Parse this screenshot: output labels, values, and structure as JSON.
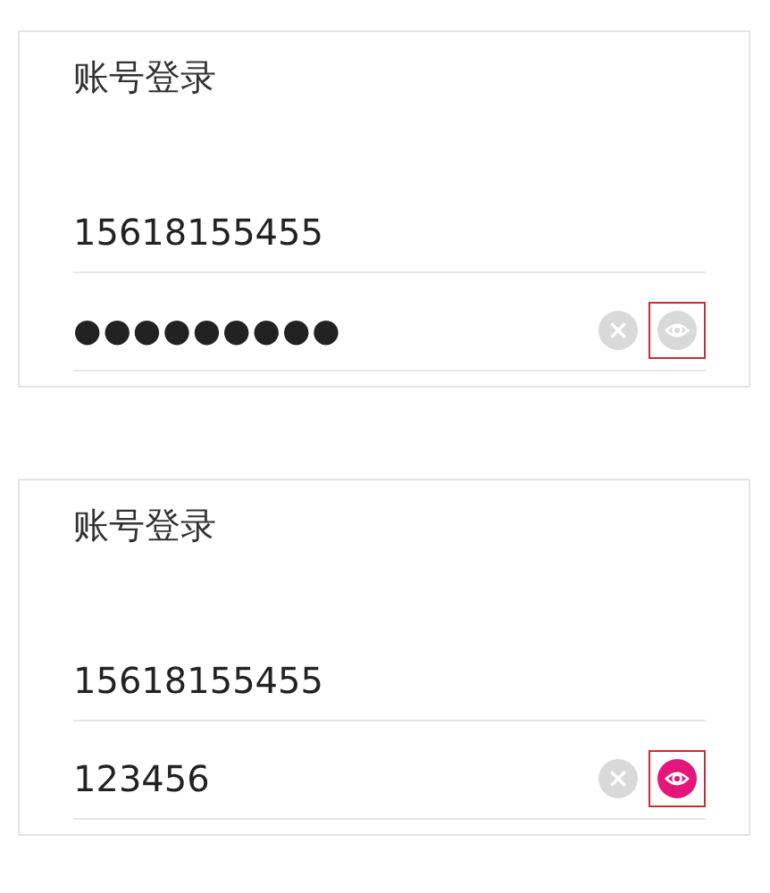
{
  "panels": [
    {
      "title": "账号登录",
      "phone": "15618155455",
      "password": {
        "value": "●●●●●●●●●",
        "visible": false
      },
      "eye_highlighted": true
    },
    {
      "title": "账号登录",
      "phone": "15618155455",
      "password": {
        "value": "123456",
        "visible": true
      },
      "eye_highlighted": true
    }
  ]
}
